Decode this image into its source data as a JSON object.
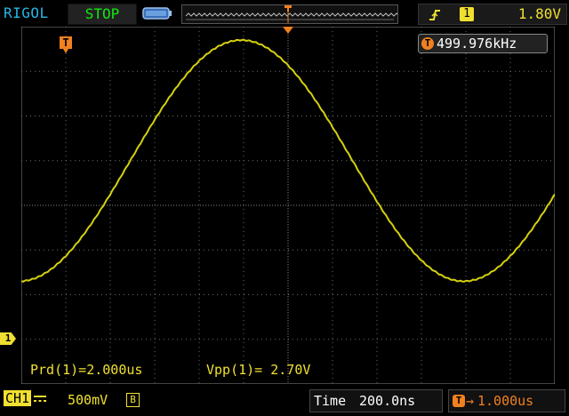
{
  "header": {
    "brand": "RIGOL",
    "run_state": "STOP",
    "trigger": {
      "edge_icon": "rising-edge-icon",
      "source": "1",
      "level": "1.80V"
    }
  },
  "screen": {
    "trigger_marker": "T",
    "frequency_icon": "T",
    "frequency": "499.976kHz",
    "channel_ground_marker": "1",
    "measurements": {
      "period": "Prd(1)=2.000us",
      "vpp": "Vpp(1)= 2.70V"
    }
  },
  "footer": {
    "channel_label": "CH1",
    "coupling_icon": "dc-coupling-icon",
    "volts_per_div": "500mV",
    "bandwidth_icon": "B",
    "time_label": "Time",
    "time_per_div": "200.0ns",
    "offset_icon": "T",
    "offset_arrow": "→",
    "offset": "1.000us"
  },
  "colors": {
    "trace": "#d4d00e",
    "brand": "#26b6e8",
    "run_state": "#12e812",
    "trigger": "#f08020",
    "grid": "#7a7a7a"
  }
}
